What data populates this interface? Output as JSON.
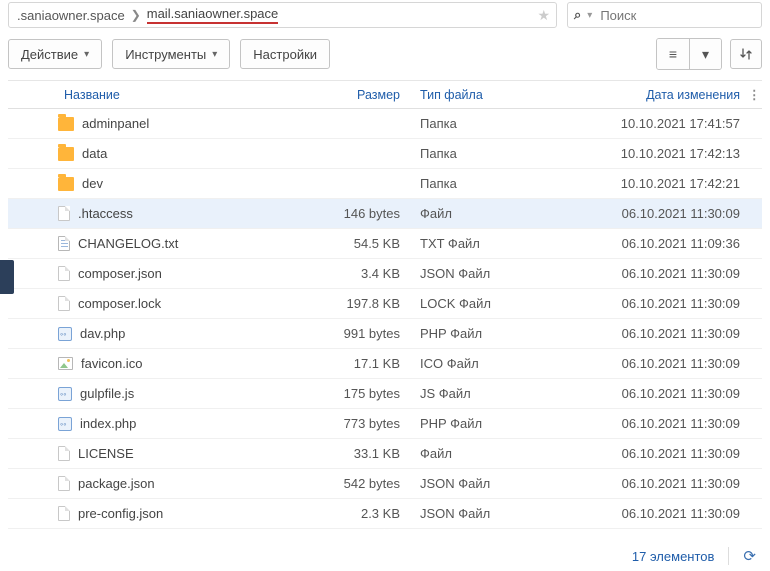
{
  "breadcrumb": {
    "root": ".saniaowner.space",
    "current": "mail.saniaowner.space"
  },
  "search": {
    "placeholder": "Поиск"
  },
  "toolbar": {
    "action_label": "Действие",
    "tools_label": "Инструменты",
    "settings_label": "Настройки"
  },
  "table": {
    "headers": {
      "name": "Название",
      "size": "Размер",
      "type": "Тип файла",
      "date": "Дата изменения"
    },
    "rows": [
      {
        "icon": "folder",
        "name": "adminpanel",
        "size": "",
        "type": "Папка",
        "date": "10.10.2021 17:41:57",
        "selected": false
      },
      {
        "icon": "folder",
        "name": "data",
        "size": "",
        "type": "Папка",
        "date": "10.10.2021 17:42:13",
        "selected": false
      },
      {
        "icon": "folder",
        "name": "dev",
        "size": "",
        "type": "Папка",
        "date": "10.10.2021 17:42:21",
        "selected": false
      },
      {
        "icon": "file",
        "name": ".htaccess",
        "size": "146 bytes",
        "type": "Файл",
        "date": "06.10.2021 11:30:09",
        "selected": true
      },
      {
        "icon": "txt",
        "name": "CHANGELOG.txt",
        "size": "54.5 KB",
        "type": "TXT Файл",
        "date": "06.10.2021 11:09:36",
        "selected": false
      },
      {
        "icon": "file",
        "name": "composer.json",
        "size": "3.4 KB",
        "type": "JSON Файл",
        "date": "06.10.2021 11:30:09",
        "selected": false
      },
      {
        "icon": "file",
        "name": "composer.lock",
        "size": "197.8 KB",
        "type": "LOCK Файл",
        "date": "06.10.2021 11:30:09",
        "selected": false
      },
      {
        "icon": "php",
        "name": "dav.php",
        "size": "991 bytes",
        "type": "PHP Файл",
        "date": "06.10.2021 11:30:09",
        "selected": false
      },
      {
        "icon": "img",
        "name": "favicon.ico",
        "size": "17.1 KB",
        "type": "ICO Файл",
        "date": "06.10.2021 11:30:09",
        "selected": false
      },
      {
        "icon": "php",
        "name": "gulpfile.js",
        "size": "175 bytes",
        "type": "JS Файл",
        "date": "06.10.2021 11:30:09",
        "selected": false
      },
      {
        "icon": "php",
        "name": "index.php",
        "size": "773 bytes",
        "type": "PHP Файл",
        "date": "06.10.2021 11:30:09",
        "selected": false
      },
      {
        "icon": "file",
        "name": "LICENSE",
        "size": "33.1 KB",
        "type": "Файл",
        "date": "06.10.2021 11:30:09",
        "selected": false
      },
      {
        "icon": "file",
        "name": "package.json",
        "size": "542 bytes",
        "type": "JSON Файл",
        "date": "06.10.2021 11:30:09",
        "selected": false
      },
      {
        "icon": "file",
        "name": "pre-config.json",
        "size": "2.3 KB",
        "type": "JSON Файл",
        "date": "06.10.2021 11:30:09",
        "selected": false
      }
    ]
  },
  "footer": {
    "count_label": "17 элементов"
  }
}
